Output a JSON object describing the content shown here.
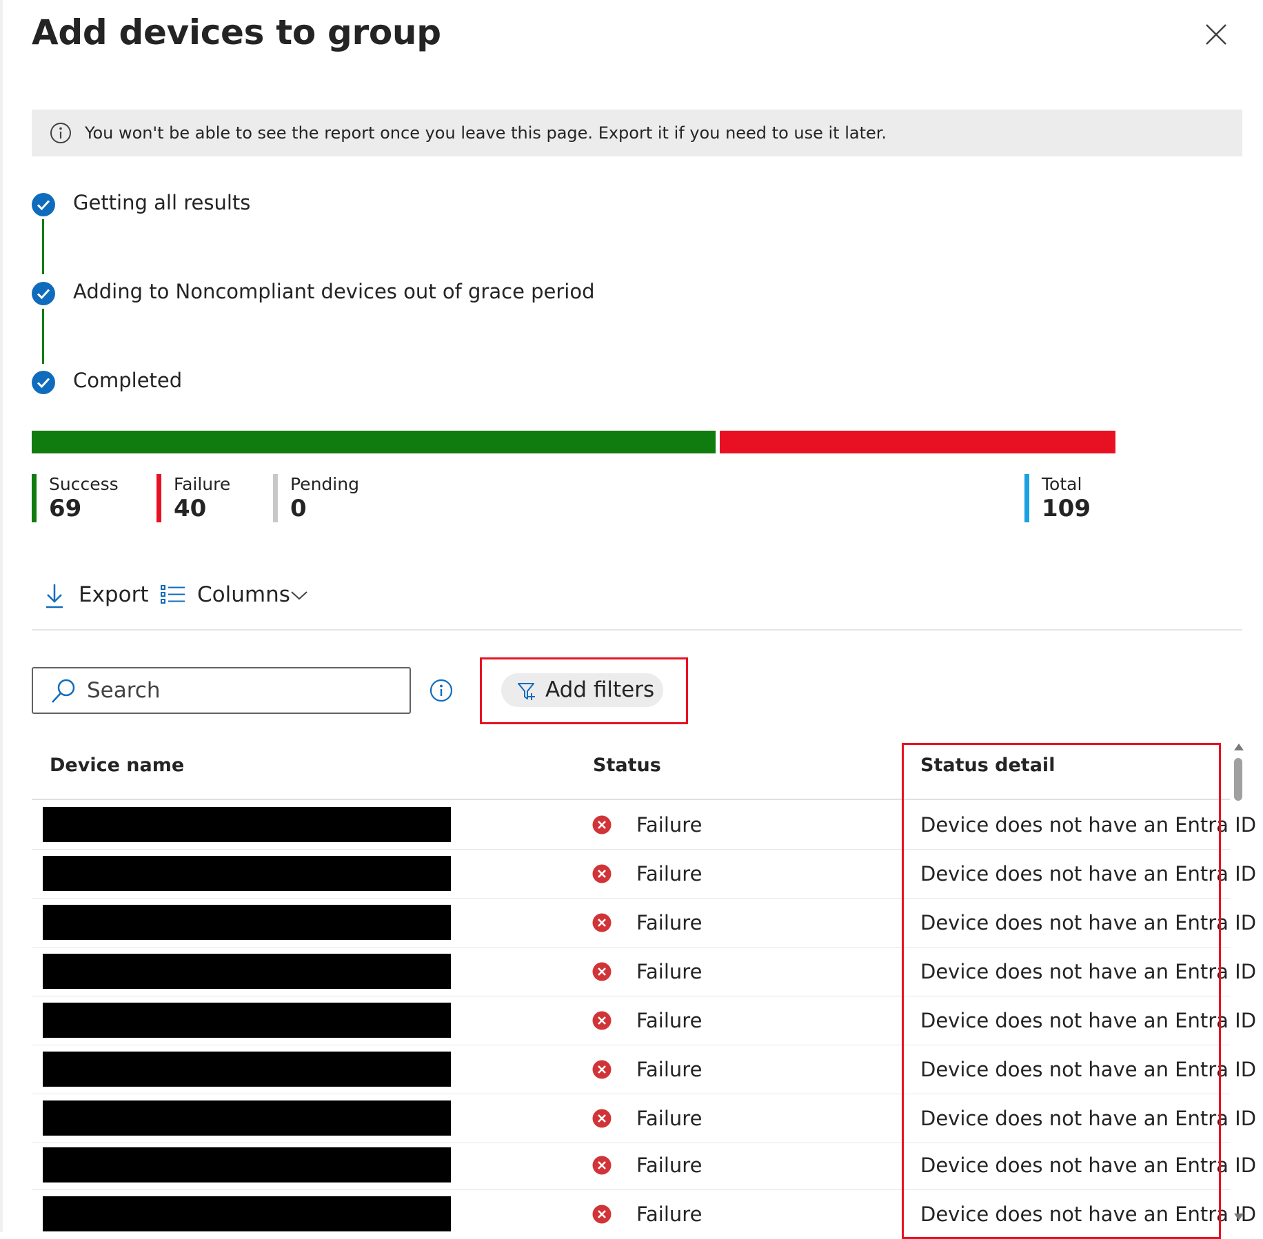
{
  "panel": {
    "title": "Add devices to group",
    "close_icon": "close-icon"
  },
  "banner": {
    "icon": "info-icon",
    "text": "You won't be able to see the report once you leave this page. Export it if you need to use it later."
  },
  "steps": [
    {
      "label": "Getting all results",
      "icon": "check-circle-icon",
      "state": "done"
    },
    {
      "label": "Adding to Noncompliant devices out of grace period",
      "icon": "check-circle-icon",
      "state": "done"
    },
    {
      "label": "Completed",
      "icon": "check-circle-icon",
      "state": "done"
    }
  ],
  "summary": {
    "success": {
      "label": "Success",
      "value": "69",
      "color": "#107c10"
    },
    "failure": {
      "label": "Failure",
      "value": "40",
      "color": "#e81123"
    },
    "pending": {
      "label": "Pending",
      "value": "0",
      "color": "#c8c8c8"
    },
    "total": {
      "label": "Total",
      "value": "109",
      "color": "#1ba1e2"
    }
  },
  "progress": {
    "success_fraction": 0.633,
    "failure_fraction": 0.367
  },
  "toolbar": {
    "export_label": "Export",
    "export_icon": "download-icon",
    "columns_label": "Columns",
    "columns_icon": "list-icon",
    "chevron_icon": "chevron-down-icon"
  },
  "search": {
    "placeholder": "Search",
    "icon": "search-icon",
    "info_icon": "info-icon"
  },
  "filters": {
    "label": "Add filters",
    "icon": "filter-add-icon"
  },
  "table": {
    "columns": [
      "Device name",
      "Status",
      "Status detail"
    ],
    "rows": [
      {
        "device": "",
        "status": "Failure",
        "detail": "Device does not have an Entra ID"
      },
      {
        "device": "",
        "status": "Failure",
        "detail": "Device does not have an Entra ID"
      },
      {
        "device": "",
        "status": "Failure",
        "detail": "Device does not have an Entra ID"
      },
      {
        "device": "",
        "status": "Failure",
        "detail": "Device does not have an Entra ID"
      },
      {
        "device": "",
        "status": "Failure",
        "detail": "Device does not have an Entra ID"
      },
      {
        "device": "",
        "status": "Failure",
        "detail": "Device does not have an Entra ID"
      },
      {
        "device": "",
        "status": "Failure",
        "detail": "Device does not have an Entra ID"
      },
      {
        "device": "",
        "status": "Failure",
        "detail": "Device does not have an Entra ID"
      },
      {
        "device": "",
        "status": "Failure",
        "detail": "Device does not have an Entra ID"
      }
    ],
    "failure_icon": "error-circle-icon"
  },
  "colors": {
    "accent_blue": "#0f6cbd",
    "success_green": "#107c10",
    "failure_red": "#e81123",
    "highlight_red": "#e81123"
  }
}
